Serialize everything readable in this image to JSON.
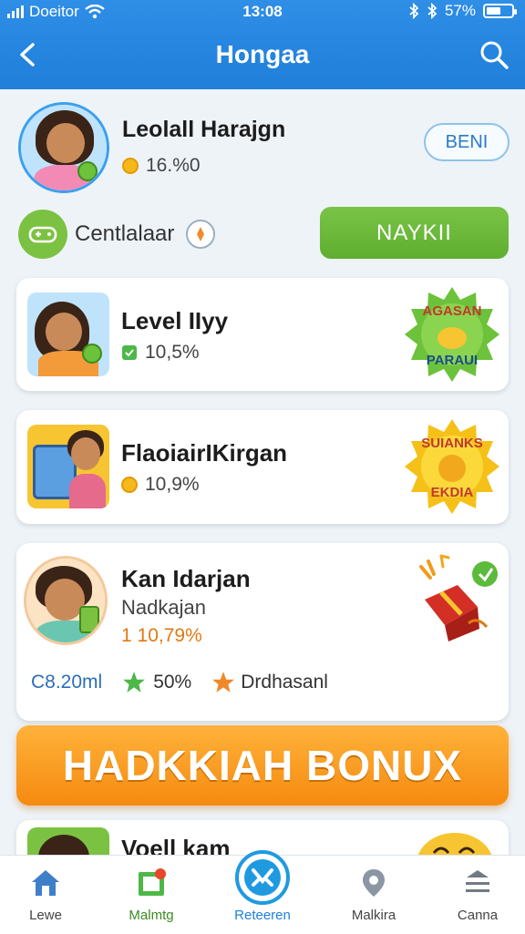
{
  "status_bar": {
    "carrier": "Doeitor",
    "time": "13:08",
    "battery": "57%",
    "battery_level": 0.57
  },
  "header": {
    "title": "Hongaa"
  },
  "profile": {
    "name": "Leolall Harajgn",
    "stat": "16.%0",
    "button_label": "BENI",
    "control_label": "Centlalaar",
    "action_label": "NAYKII"
  },
  "cards": [
    {
      "title": "Level IIyy",
      "stat": "10,5%",
      "badge_top": "AGASAN",
      "badge_bottom": "PARAUI"
    },
    {
      "title": "FlaoiairIKirgan",
      "stat": "10,9%",
      "badge_top": "SUIANKS",
      "badge_bottom": "EKDIA"
    },
    {
      "title": "Kan Idarjan",
      "subtitle": "Nadkajan",
      "stat": "1 10,79%",
      "stats": [
        {
          "label": "C8.20ml"
        },
        {
          "label": "50%"
        },
        {
          "label": "Drdhasanl"
        }
      ]
    }
  ],
  "bonus": {
    "label": "HADKKIAH BONUX"
  },
  "partial_card": {
    "title": "Voell kam"
  },
  "bottom_nav": [
    {
      "label": "Lewe",
      "icon": "home-icon"
    },
    {
      "label": "Malmtg",
      "icon": "map-icon"
    },
    {
      "label": "Reteeren",
      "icon": "center-action-icon"
    },
    {
      "label": "Malkira",
      "icon": "location-icon"
    },
    {
      "label": "Canna",
      "icon": "menu-icon"
    }
  ],
  "colors": {
    "header_blue": "#1f7fd9",
    "action_green": "#66b535",
    "bonus_orange": "#f58a10",
    "stat_orange": "#e07a12"
  }
}
